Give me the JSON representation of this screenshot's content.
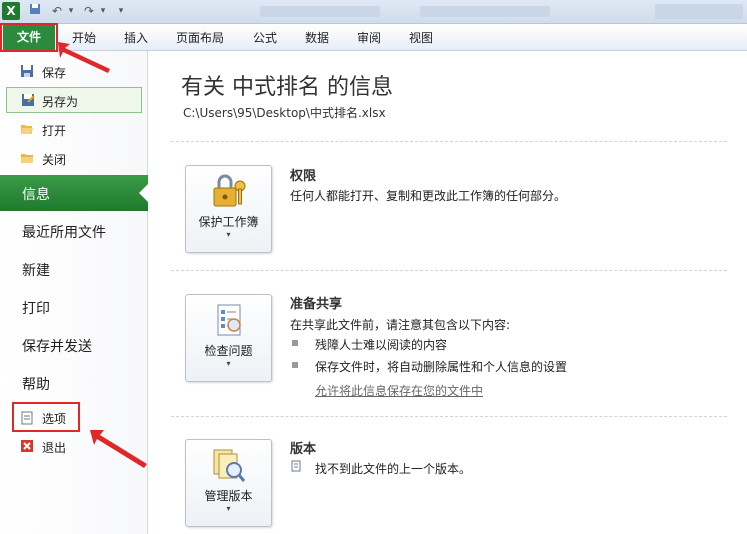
{
  "titlebar": {
    "app_icon": "excel-icon",
    "undo": "↶",
    "redo": "↷",
    "dropdown": "▾"
  },
  "ribbon": {
    "file": "文件",
    "tabs": [
      "开始",
      "插入",
      "页面布局",
      "公式",
      "数据",
      "审阅",
      "视图"
    ]
  },
  "left": {
    "commands_top": [
      {
        "label": "保存",
        "icon": "save-icon"
      },
      {
        "label": "另存为",
        "icon": "save-as-icon"
      },
      {
        "label": "打开",
        "icon": "folder-open-icon"
      },
      {
        "label": "关闭",
        "icon": "folder-close-icon"
      }
    ],
    "info": "信息",
    "items": [
      "最近所用文件",
      "新建",
      "打印",
      "保存并发送",
      "帮助"
    ],
    "commands_bottom": [
      {
        "label": "选项",
        "icon": "options-icon"
      },
      {
        "label": "退出",
        "icon": "exit-icon"
      }
    ]
  },
  "main": {
    "title": "有关 中式排名 的信息",
    "path": "C:\\Users\\95\\Desktop\\中式排名.xlsx",
    "sections": [
      {
        "button": "保护工作簿",
        "icon": "lock-key-icon",
        "heading": "权限",
        "text": "任何人都能打开、复制和更改此工作簿的任何部分。"
      },
      {
        "button": "检查问题",
        "icon": "checklist-icon",
        "heading": "准备共享",
        "text": "在共享此文件前，请注意其包含以下内容:",
        "bullets": [
          "残障人士难以阅读的内容",
          "保存文件时，将自动删除属性和个人信息的设置"
        ],
        "link": "允许将此信息保存在您的文件中"
      },
      {
        "button": "管理版本",
        "icon": "versions-icon",
        "heading": "版本",
        "text": "找不到此文件的上一个版本。"
      }
    ],
    "caret": "▾"
  },
  "colors": {
    "accent_green": "#2b8a3b",
    "annotation_red": "#e02828"
  }
}
